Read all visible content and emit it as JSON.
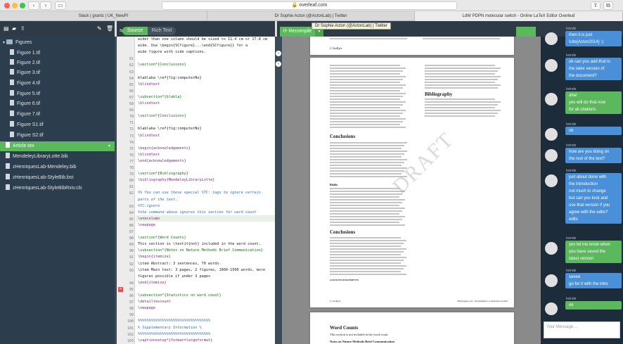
{
  "browser": {
    "url": "overleaf.com",
    "tabs": [
      "Slack | grants | UK_NewPI",
      "Dr Sophie Acton (@ActonLab) | Twitter",
      "LdW PDPN molecular switch - Online LaTeX Editor Overleaf"
    ],
    "tooltip": "Dr Sophie Acton (@ActonLab) | Twitter"
  },
  "editor_header": {
    "source_label": "Source",
    "richtext_label": "Rich Text",
    "recompile_label": "Recompile"
  },
  "filetree": {
    "folder": "Figures",
    "figures": [
      "Figure 1.tif",
      "Figure 2.tif",
      "Figure 3.tif",
      "Figure 4.tif",
      "Figure 5.tif",
      "Figure 6.tif",
      "Figure 7.tif",
      "Figure S1.tif",
      "Figure S2.tif"
    ],
    "active_file": "Article.tex",
    "files": [
      "MendeleyLibraryLotte.bib",
      "zHenriquesLab-Mendeley.bib",
      "zHenriquesLab-StyleBib.bst",
      "zHenriquesLab-StyleBibRxiv.cls"
    ]
  },
  "code": {
    "lines": [
      {
        "n": "",
        "t": "wider than one column should be sized to 11.4 cm or 17.8 cm",
        "c": ""
      },
      {
        "n": "",
        "t": "wide. Use \\begin{SCfigure}...\\end{SCfigure}} for a",
        "c": ""
      },
      {
        "n": "",
        "t": "wide figure with side captions.",
        "c": ""
      },
      {
        "n": "61",
        "t": "",
        "c": ""
      },
      {
        "n": "62",
        "t": "\\section*{Conclusions}",
        "c": "sec"
      },
      {
        "n": "63",
        "t": "",
        "c": ""
      },
      {
        "n": "64",
        "t": "blablaba \\ref{fig:computerNo}",
        "c": ""
      },
      {
        "n": "65",
        "t": "\\blindtext",
        "c": "cmd"
      },
      {
        "n": "66",
        "t": "",
        "c": ""
      },
      {
        "n": "67",
        "t": "\\subsection*{blabla}",
        "c": "sec"
      },
      {
        "n": "68",
        "t": "\\blindtext",
        "c": "cmd"
      },
      {
        "n": "69",
        "t": "",
        "c": ""
      },
      {
        "n": "70",
        "t": "\\section*{Conclusions}",
        "c": "sec"
      },
      {
        "n": "71",
        "t": "",
        "c": ""
      },
      {
        "n": "72",
        "t": "blablaba \\ref{fig:computerNo}",
        "c": ""
      },
      {
        "n": "73",
        "t": "\\blindtext",
        "c": "cmd"
      },
      {
        "n": "74",
        "t": "",
        "c": ""
      },
      {
        "n": "75",
        "t": "\\begin{acknowledgements}",
        "c": "cmd"
      },
      {
        "n": "76",
        "t": "\\blindtext",
        "c": "cmd"
      },
      {
        "n": "77",
        "t": "\\end{acknowledgements}",
        "c": "cmd"
      },
      {
        "n": "78",
        "t": "",
        "c": ""
      },
      {
        "n": "79",
        "t": "\\section*{Bibliography}",
        "c": "sec"
      },
      {
        "n": "80",
        "t": "\\bibliography{MendeleyLibraryLotte}",
        "c": "cmd"
      },
      {
        "n": "81",
        "t": "",
        "c": ""
      },
      {
        "n": "82",
        "t": "%% You can use these special %TC: tags to ignore certain",
        "c": "com"
      },
      {
        "n": "",
        "t": "parts of the text.",
        "c": "com"
      },
      {
        "n": "83",
        "t": "%TC:ignore",
        "c": "com"
      },
      {
        "n": "84",
        "t": "%the command above ignores this section for word count",
        "c": "com"
      },
      {
        "n": "85",
        "t": "\\onecolumn",
        "c": "cmd"
      },
      {
        "n": "86",
        "t": "\\newpage",
        "c": "cmd"
      },
      {
        "n": "87",
        "t": "",
        "c": ""
      },
      {
        "n": "88",
        "t": "\\section*{Word Counts}",
        "c": "sec"
      },
      {
        "n": "89",
        "t": "This section is \\textit{not} included in the word count.",
        "c": ""
      },
      {
        "n": "90",
        "t": "\\subsection*{Notes on Nature Methods Brief Communication}",
        "c": "sec"
      },
      {
        "n": "91",
        "t": "\\begin{itemize}",
        "c": "cmd"
      },
      {
        "n": "92",
        "t": "\\item Abstract: 3 sentences, 70 words.",
        "c": ""
      },
      {
        "n": "93",
        "t": "\\item Main text: 3 pages, 2 figures, 1000-1500 words, more",
        "c": ""
      },
      {
        "n": "",
        "t": "figures possible if under 3 pages",
        "c": ""
      },
      {
        "n": "94",
        "t": "\\end{itemize}",
        "c": "cmd"
      },
      {
        "n": "95",
        "t": "",
        "c": ""
      },
      {
        "n": "96",
        "t": "\\subsection*{Statistics on word count}",
        "c": "sec"
      },
      {
        "n": "97",
        "t": "\\detailtexcount",
        "c": "cmd"
      },
      {
        "n": "98",
        "t": "\\newpage",
        "c": "cmd"
      },
      {
        "n": "99",
        "t": "",
        "c": ""
      },
      {
        "n": "100",
        "t": "%%%%%%%%%%%%%%%%%%%%%%%%%%%%%%%%%",
        "c": "com"
      },
      {
        "n": "101",
        "t": "% Supplementary Information %",
        "c": "com"
      },
      {
        "n": "102",
        "t": "%%%%%%%%%%%%%%%%%%%%%%%%%%%%%%%%%",
        "c": "com"
      },
      {
        "n": "103",
        "t": "\\captionsetup*{format=largeformat}",
        "c": "cmd"
      },
      {
        "n": "104",
        "t": "\\section{Something about something} \\label{note:Note1}",
        "c": "sec"
      },
      {
        "n": "105",
        "t": "\\blindtext",
        "c": "cmd"
      }
    ]
  },
  "pdf": {
    "bibliography_heading": "Bibliography",
    "conclusions_heading": "Conclusions",
    "conclusions_heading_2": "Conclusions",
    "acknowledgements_heading": "ACKNOWLEDGEMENTS",
    "subhead": "Blabla",
    "watermark": "DRAFT",
    "word_counts_heading": "Word Counts",
    "word_counts_text": "This section is not included in the word count.",
    "notes_heading": "Notes on Nature Methods Brief Communication",
    "footer_left": "2  |  bioRχiv",
    "footer_right": "Henriques et al.  |  Postsubmit to a molecular switch"
  },
  "chat": {
    "username": "Iwinde",
    "messages": [
      {
        "lines": [
          "then it is just",
          "\\cite{Acton2014} :)"
        ],
        "color": "blue"
      },
      {
        "lines": [
          "ok can you add that to",
          "the latex version of",
          "the document?"
        ],
        "color": "blue"
      },
      {
        "lines": [
          "aha!",
          "yes will do that now",
          "for all citations"
        ],
        "color": "green"
      },
      {
        "lines": [
          "ok"
        ],
        "color": "blue"
      },
      {
        "lines": [
          "how are you doing on",
          "the rest of the text?"
        ],
        "color": "blue"
      },
      {
        "lines": [
          "just about done with",
          "the introduction",
          "not much to change",
          "but can you look and",
          "use that version if you",
          "agree with the edits?",
          "edits"
        ],
        "color": "blue"
      },
      {
        "lines": [
          "yes let me know when",
          "you have saved the",
          "latest version"
        ],
        "color": "green"
      },
      {
        "lines": [
          "saved",
          "go for it with the intro"
        ],
        "color": "blue"
      },
      {
        "lines": [
          "ok"
        ],
        "color": "green"
      }
    ],
    "input_placeholder": "Your Message..."
  }
}
